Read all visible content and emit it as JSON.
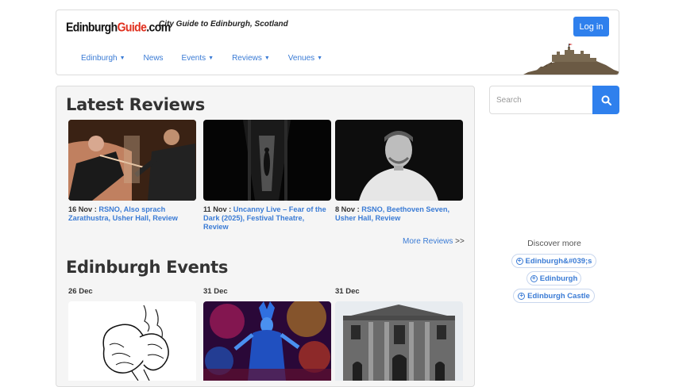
{
  "header": {
    "logo_main": "Edinburgh",
    "logo_accent": "Guide",
    "logo_suffix": ".com",
    "tagline": "City Guide to Edinburgh, Scotland",
    "login_label": "Log in",
    "nav": [
      {
        "label": "Edinburgh",
        "dropdown": true
      },
      {
        "label": "News",
        "dropdown": false
      },
      {
        "label": "Events",
        "dropdown": true
      },
      {
        "label": "Reviews",
        "dropdown": true
      },
      {
        "label": "Venues",
        "dropdown": true
      }
    ]
  },
  "reviews": {
    "title": "Latest Reviews",
    "items": [
      {
        "date": "16 Nov",
        "sep": " : ",
        "link": "RSNO, Also sprach Zarathustra, Usher Hall, Review"
      },
      {
        "date": "11 Nov",
        "sep": " : ",
        "link": "Uncanny Live – Fear of the Dark (2025), Festival Theatre, Review"
      },
      {
        "date": "8 Nov",
        "sep": " : ",
        "link": "RSNO, Beethoven Seven, Usher Hall, Review"
      }
    ],
    "more_label": "More Reviews",
    "more_arrows": ">>"
  },
  "events": {
    "title": "Edinburgh Events",
    "items": [
      {
        "date": "26 Dec"
      },
      {
        "date": "31 Dec"
      },
      {
        "date": "31 Dec"
      }
    ]
  },
  "sidebar": {
    "search_placeholder": "Search",
    "discover_label": "Discover more",
    "pills": [
      "Edinburgh&#039;s",
      "Edinburgh",
      "Edinburgh Castle"
    ]
  },
  "colors": {
    "accent": "#2f80ed",
    "link": "#3a7bd5",
    "logo_red": "#e0301e"
  }
}
